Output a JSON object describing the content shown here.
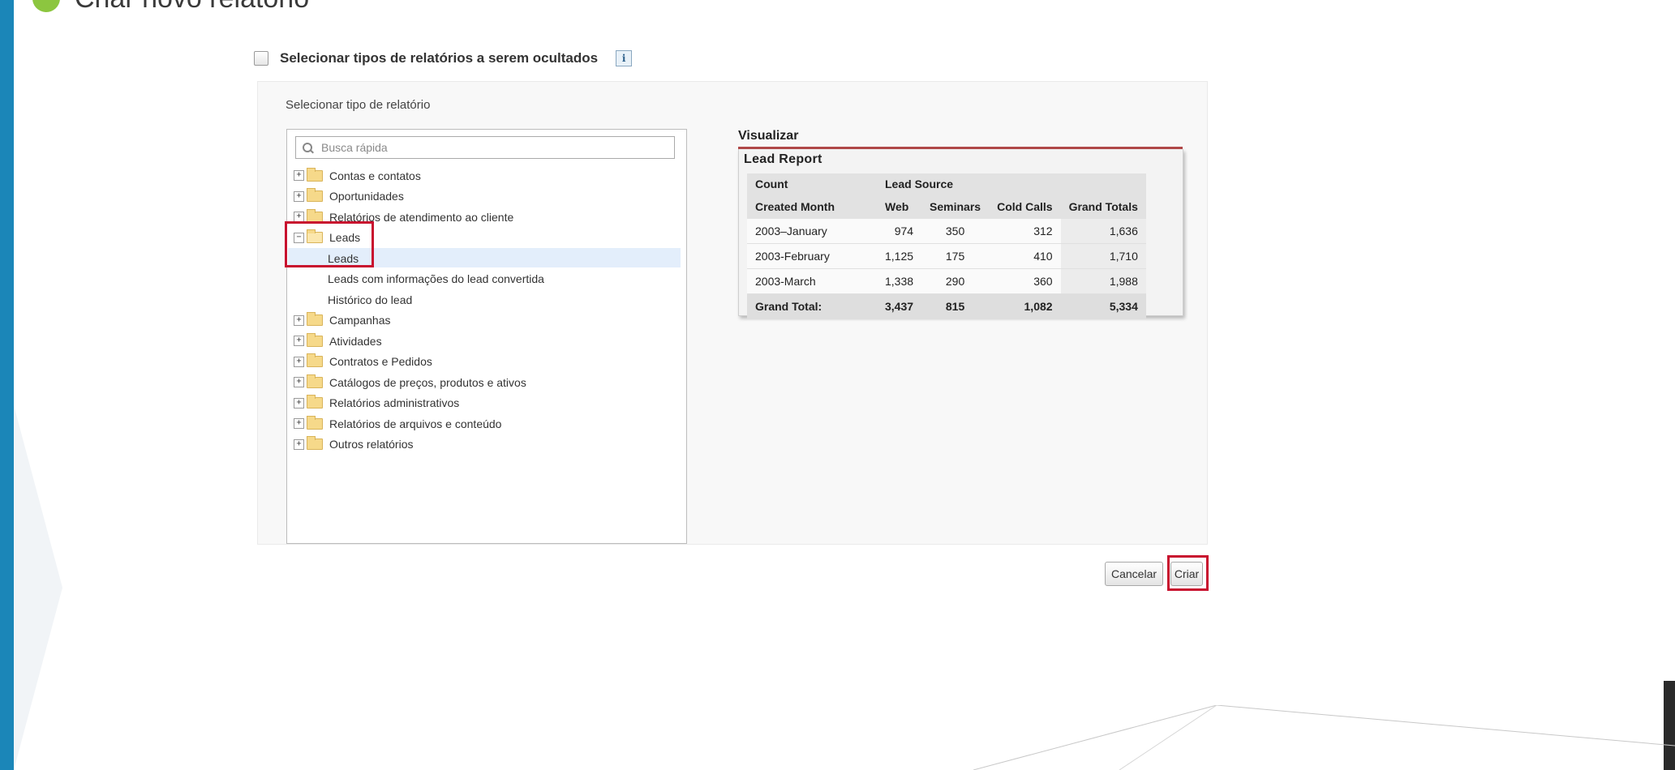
{
  "page": {
    "title": "Criar novo relatório"
  },
  "hide_types": {
    "label": "Selecionar tipos de relatórios a serem ocultados",
    "info": "i"
  },
  "selector": {
    "title": "Selecionar tipo de relatório",
    "search_placeholder": "Busca rápida",
    "tree": [
      {
        "label": "Contas e contatos",
        "expander": "+"
      },
      {
        "label": "Oportunidades",
        "expander": "+"
      },
      {
        "label": "Relatórios de atendimento ao cliente",
        "expander": "+"
      },
      {
        "label": "Leads",
        "expander": "−",
        "expanded": true
      },
      {
        "label": "Leads",
        "child": true,
        "selected": true
      },
      {
        "label": "Leads com informações do lead convertida",
        "child": true
      },
      {
        "label": "Histórico do lead",
        "child": true
      },
      {
        "label": "Campanhas",
        "expander": "+"
      },
      {
        "label": "Atividades",
        "expander": "+"
      },
      {
        "label": "Contratos e Pedidos",
        "expander": "+"
      },
      {
        "label": "Catálogos de preços, produtos e ativos",
        "expander": "+"
      },
      {
        "label": "Relatórios administrativos",
        "expander": "+"
      },
      {
        "label": "Relatórios de arquivos e conteúdo",
        "expander": "+"
      },
      {
        "label": "Outros relatórios",
        "expander": "+"
      }
    ]
  },
  "preview": {
    "title": "Visualizar",
    "report_name": "Lead Report",
    "header1": [
      "Count",
      "Lead Source"
    ],
    "header2": [
      "Created Month",
      "Web",
      "Seminars",
      "Cold Calls",
      "Grand Totals"
    ],
    "rows": [
      [
        "2003–January",
        "974",
        "350",
        "312",
        "1,636"
      ],
      [
        "2003-February",
        "1,125",
        "175",
        "410",
        "1,710"
      ],
      [
        "2003-March",
        "1,338",
        "290",
        "360",
        "1,988"
      ]
    ],
    "total": [
      "Grand Total:",
      "3,437",
      "815",
      "1,082",
      "5,334"
    ]
  },
  "buttons": {
    "cancel": "Cancelar",
    "create": "Criar"
  },
  "colors": {
    "accent_bar": "#1b86b8",
    "highlight": "#c8102e",
    "preview_rule": "#b04848"
  }
}
